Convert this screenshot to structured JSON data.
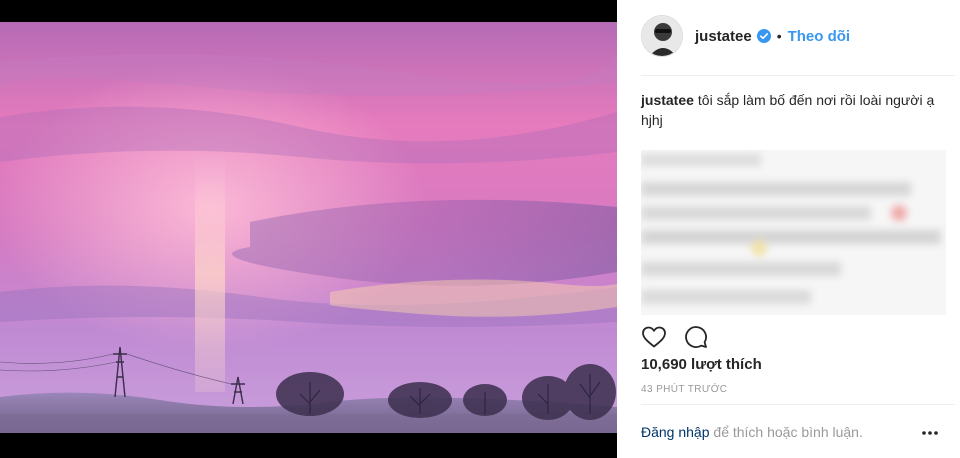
{
  "post": {
    "username": "justatee",
    "follow_label": "Theo dõi",
    "separator_dot": "•",
    "caption_user": "justatee",
    "caption_text": "tôi sắp làm bố đến nơi rồi loài người ạ",
    "caption_line2": "hjhj",
    "likes_text": "10,690 lượt thích",
    "time_text": "43 PHÚT TRƯỚC",
    "footer_login": "Đăng nhập",
    "footer_rest": " để thích hoặc bình luận."
  },
  "icons": {
    "verified": "verified-badge-icon",
    "like": "heart-icon",
    "comment": "comment-icon",
    "more": "more-options-icon"
  },
  "colors": {
    "accent": "#3897f0",
    "link_dark": "#003569",
    "muted": "#999999",
    "text": "#262626"
  }
}
